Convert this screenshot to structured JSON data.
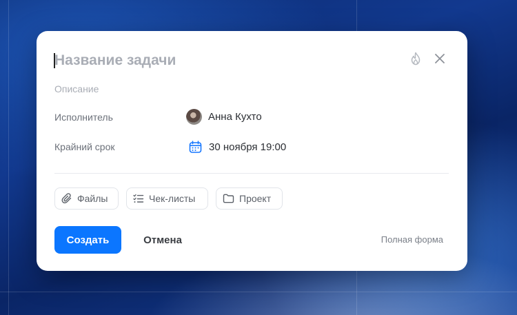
{
  "task_form": {
    "title_placeholder": "Название задачи",
    "description_placeholder": "Описание",
    "fields": {
      "assignee": {
        "label": "Исполнитель",
        "value": "Анна Кухто"
      },
      "deadline": {
        "label": "Крайний срок",
        "value": "30 ноября 19:00"
      }
    },
    "chips": {
      "files": "Файлы",
      "checklists": "Чек-листы",
      "project": "Проект"
    },
    "actions": {
      "create": "Создать",
      "cancel": "Отмена",
      "full_form": "Полная форма"
    },
    "icons": {
      "priority": "flame-icon",
      "close": "close-icon",
      "calendar": "calendar-icon",
      "files": "paperclip-icon",
      "checklists": "checklist-icon",
      "project": "folder-icon"
    },
    "colors": {
      "accent": "#0b76ff",
      "placeholder": "#a9adb5"
    }
  }
}
